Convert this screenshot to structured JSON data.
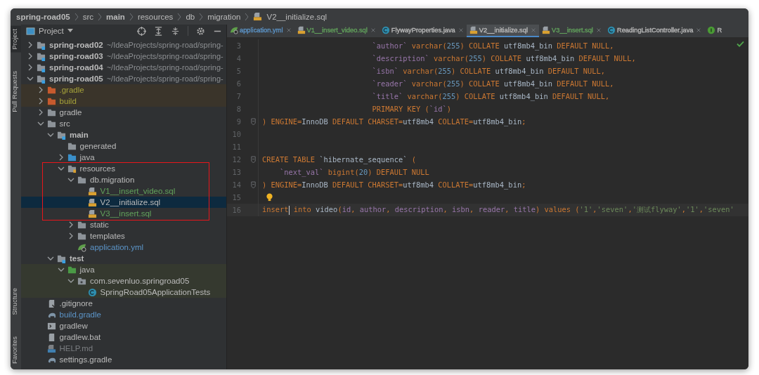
{
  "breadcrumb": [
    {
      "label": "spring-road05",
      "bold": true,
      "kind": "module"
    },
    {
      "label": "src",
      "bold": false,
      "kind": "folder"
    },
    {
      "label": "main",
      "bold": true,
      "kind": "folder"
    },
    {
      "label": "resources",
      "bold": false,
      "kind": "folder"
    },
    {
      "label": "db",
      "bold": false,
      "kind": "folder"
    },
    {
      "label": "migration",
      "bold": false,
      "kind": "folder"
    },
    {
      "label": "V2__initialize.sql",
      "bold": false,
      "kind": "sql"
    }
  ],
  "tool_strip": {
    "top": [
      {
        "label": "Project",
        "selected": true
      },
      {
        "label": "Pull Requests",
        "selected": false
      }
    ],
    "bottom": [
      {
        "label": "Structure",
        "selected": false
      },
      {
        "label": "Favorites",
        "selected": false
      }
    ]
  },
  "project_panel": {
    "title": "Project",
    "tree": [
      {
        "label": "spring-road02",
        "hint": "~/IdeaProjects/spring-road/spring-",
        "kind": "module",
        "expanded": false,
        "selected": false
      },
      {
        "label": "spring-road03",
        "hint": "~/IdeaProjects/spring-road/spring-",
        "kind": "module",
        "expanded": false,
        "selected": false
      },
      {
        "label": "spring-road04",
        "hint": "~/IdeaProjects/spring-road/spring-",
        "kind": "module",
        "expanded": false,
        "selected": false
      },
      {
        "label": "spring-road05",
        "hint": "~/IdeaProjects/spring-road/spring-",
        "kind": "module",
        "expanded": true,
        "selected": false,
        "children": [
          {
            "label": ".gradle",
            "kind": "excluded-folder",
            "color": "#a6a33a",
            "expanded": false,
            "selected": false
          },
          {
            "label": "build",
            "kind": "excluded-folder",
            "color": "#a6a33a",
            "expanded": false,
            "selected": false
          },
          {
            "label": "gradle",
            "kind": "folder",
            "expanded": false,
            "selected": false
          },
          {
            "label": "src",
            "kind": "folder",
            "expanded": true,
            "selected": false,
            "children": [
              {
                "label": "main",
                "kind": "module",
                "expanded": true,
                "selected": false,
                "children": [
                  {
                    "label": "generated",
                    "kind": "folder",
                    "selected": false
                  },
                  {
                    "label": "java",
                    "kind": "source-folder",
                    "expanded": false,
                    "selected": false
                  },
                  {
                    "label": "resources",
                    "kind": "resources-folder",
                    "expanded": true,
                    "selected": false,
                    "children": [
                      {
                        "label": "db.migration",
                        "kind": "folder",
                        "expanded": true,
                        "selected": false,
                        "children": [
                          {
                            "label": "V1__insert_video.sql",
                            "kind": "sql",
                            "color": "#62a35c",
                            "selected": false
                          },
                          {
                            "label": "V2__initialize.sql",
                            "kind": "sql",
                            "selected": true
                          },
                          {
                            "label": "V3__insert.sql",
                            "kind": "sql",
                            "color": "#62a35c",
                            "selected": false
                          }
                        ]
                      },
                      {
                        "label": "static",
                        "kind": "folder",
                        "expanded": false,
                        "selected": false
                      },
                      {
                        "label": "templates",
                        "kind": "folder",
                        "expanded": false,
                        "selected": false
                      },
                      {
                        "label": "application.yml",
                        "kind": "yml",
                        "color": "#5c95c9",
                        "selected": false
                      }
                    ]
                  }
                ]
              },
              {
                "label": "test",
                "kind": "module",
                "expanded": true,
                "selected": false,
                "children": [
                  {
                    "label": "java",
                    "kind": "test-folder",
                    "expanded": true,
                    "selected": false,
                    "children": [
                      {
                        "label": "com.sevenluo.springroad05",
                        "kind": "test-package",
                        "expanded": true,
                        "selected": false,
                        "children": [
                          {
                            "label": "SpringRoad05ApplicationTests",
                            "kind": "test-class",
                            "selected": false
                          }
                        ]
                      }
                    ]
                  }
                ]
              }
            ]
          },
          {
            "label": ".gitignore",
            "kind": "gitignore",
            "selected": false
          },
          {
            "label": "build.gradle",
            "kind": "gradle",
            "color": "#5c95c9",
            "selected": false
          },
          {
            "label": "gradlew",
            "kind": "script",
            "selected": false
          },
          {
            "label": "gradlew.bat",
            "kind": "text",
            "selected": false
          },
          {
            "label": "HELP.md",
            "kind": "md",
            "color": "#7a7d80",
            "selected": false
          },
          {
            "label": "settings.gradle",
            "kind": "gradle",
            "selected": false
          }
        ]
      }
    ]
  },
  "tabs": [
    {
      "label": "application.yml",
      "kind": "yml",
      "color": "#5c95c9",
      "selected": false
    },
    {
      "label": "V1__insert_video.sql",
      "kind": "sql",
      "color": "#62a35c",
      "selected": false
    },
    {
      "label": "FlywayProperties.java",
      "kind": "java-class",
      "selected": false
    },
    {
      "label": "V2__initialize.sql",
      "kind": "sql",
      "selected": true
    },
    {
      "label": "V3__insert.sql",
      "kind": "sql",
      "color": "#62a35c",
      "selected": false
    },
    {
      "label": "ReadingListController.java",
      "kind": "java-class",
      "selected": false
    },
    {
      "label": "R",
      "kind": "interface",
      "selected": false
    }
  ],
  "editor": {
    "lines": [
      {
        "number": "3",
        "tokens": [
          {
            "t": "                         `author`",
            "kind": "column"
          },
          {
            "t": " varchar(",
            "kind": "keyword"
          },
          {
            "t": "255",
            "kind": "number"
          },
          {
            "t": ") COLLATE ",
            "kind": "keyword"
          },
          {
            "t": "utf8mb4_bin",
            "kind": "plain"
          },
          {
            "t": " DEFAULT NULL,",
            "kind": "keyword"
          }
        ]
      },
      {
        "number": "4",
        "tokens": [
          {
            "t": "                         `description`",
            "kind": "column"
          },
          {
            "t": " varchar(",
            "kind": "keyword"
          },
          {
            "t": "255",
            "kind": "number"
          },
          {
            "t": ") COLLATE ",
            "kind": "keyword"
          },
          {
            "t": "utf8mb4_bin",
            "kind": "plain"
          },
          {
            "t": " DEFAULT NULL,",
            "kind": "keyword"
          }
        ]
      },
      {
        "number": "5",
        "tokens": [
          {
            "t": "                         `isbn`",
            "kind": "column"
          },
          {
            "t": " varchar(",
            "kind": "keyword"
          },
          {
            "t": "255",
            "kind": "number"
          },
          {
            "t": ") COLLATE ",
            "kind": "keyword"
          },
          {
            "t": "utf8mb4_bin",
            "kind": "plain"
          },
          {
            "t": " DEFAULT NULL,",
            "kind": "keyword"
          }
        ]
      },
      {
        "number": "6",
        "tokens": [
          {
            "t": "                         `reader`",
            "kind": "column"
          },
          {
            "t": " varchar(",
            "kind": "keyword"
          },
          {
            "t": "255",
            "kind": "number"
          },
          {
            "t": ") COLLATE ",
            "kind": "keyword"
          },
          {
            "t": "utf8mb4_bin",
            "kind": "plain"
          },
          {
            "t": " DEFAULT NULL,",
            "kind": "keyword"
          }
        ]
      },
      {
        "number": "7",
        "tokens": [
          {
            "t": "                         `title`",
            "kind": "column"
          },
          {
            "t": " varchar(",
            "kind": "keyword"
          },
          {
            "t": "255",
            "kind": "number"
          },
          {
            "t": ") COLLATE ",
            "kind": "keyword"
          },
          {
            "t": "utf8mb4_bin",
            "kind": "plain"
          },
          {
            "t": " DEFAULT NULL,",
            "kind": "keyword"
          }
        ]
      },
      {
        "number": "8",
        "tokens": [
          {
            "t": "                         PRIMARY KEY (",
            "kind": "keyword"
          },
          {
            "t": "`id`",
            "kind": "column"
          },
          {
            "t": ")",
            "kind": "keyword"
          }
        ]
      },
      {
        "number": "9",
        "fold": true,
        "tokens": [
          {
            "t": ") ENGINE=",
            "kind": "keyword"
          },
          {
            "t": "InnoDB",
            "kind": "plain"
          },
          {
            "t": " DEFAULT CHARSET=",
            "kind": "keyword"
          },
          {
            "t": "utf8mb4",
            "kind": "plain"
          },
          {
            "t": " COLLATE=",
            "kind": "keyword"
          },
          {
            "t": "utf8mb4_bin",
            "kind": "plain"
          },
          {
            "t": ";",
            "kind": "keyword"
          }
        ]
      },
      {
        "number": "10"
      },
      {
        "number": "11"
      },
      {
        "number": "12",
        "fold": true,
        "tokens": [
          {
            "t": "CREATE TABLE ",
            "kind": "keyword"
          },
          {
            "t": "`hibernate_sequence`",
            "kind": "plain"
          },
          {
            "t": " (",
            "kind": "keyword"
          }
        ]
      },
      {
        "number": "13",
        "tokens": [
          {
            "t": "    `next_val`",
            "kind": "column"
          },
          {
            "t": " bigint(",
            "kind": "keyword"
          },
          {
            "t": "20",
            "kind": "number"
          },
          {
            "t": ") DEFAULT NULL",
            "kind": "keyword"
          }
        ]
      },
      {
        "number": "14",
        "fold": true,
        "tokens": [
          {
            "t": ") ENGINE=",
            "kind": "keyword"
          },
          {
            "t": "InnoDB",
            "kind": "plain"
          },
          {
            "t": " DEFAULT CHARSET=",
            "kind": "keyword"
          },
          {
            "t": "utf8mb4",
            "kind": "plain"
          },
          {
            "t": " COLLATE=",
            "kind": "keyword"
          },
          {
            "t": "utf8mb4_bin",
            "kind": "plain"
          },
          {
            "t": ";",
            "kind": "keyword"
          }
        ]
      },
      {
        "number": "15",
        "bulb": true
      },
      {
        "number": "16",
        "current": true,
        "tokens": [
          {
            "t": "insert",
            "kind": "keyword",
            "caret_after": true
          },
          {
            "t": " into ",
            "kind": "keyword"
          },
          {
            "t": "video",
            "kind": "plain"
          },
          {
            "t": "(",
            "kind": "keyword"
          },
          {
            "t": "id",
            "kind": "column"
          },
          {
            "t": ", ",
            "kind": "keyword"
          },
          {
            "t": "author",
            "kind": "column"
          },
          {
            "t": ", ",
            "kind": "keyword"
          },
          {
            "t": "description",
            "kind": "column"
          },
          {
            "t": ", ",
            "kind": "keyword"
          },
          {
            "t": "isbn",
            "kind": "column"
          },
          {
            "t": ", ",
            "kind": "keyword"
          },
          {
            "t": "reader",
            "kind": "column"
          },
          {
            "t": ", ",
            "kind": "keyword"
          },
          {
            "t": "title",
            "kind": "column"
          },
          {
            "t": ") values (",
            "kind": "keyword"
          },
          {
            "t": "'1'",
            "kind": "string"
          },
          {
            "t": ",",
            "kind": "keyword"
          },
          {
            "t": "'seven'",
            "kind": "string"
          },
          {
            "t": ",",
            "kind": "keyword"
          },
          {
            "t": "'测试flyway'",
            "kind": "string"
          },
          {
            "t": ",",
            "kind": "keyword"
          },
          {
            "t": "'1'",
            "kind": "string"
          },
          {
            "t": ",",
            "kind": "keyword"
          },
          {
            "t": "'seven'",
            "kind": "string"
          }
        ]
      }
    ]
  }
}
